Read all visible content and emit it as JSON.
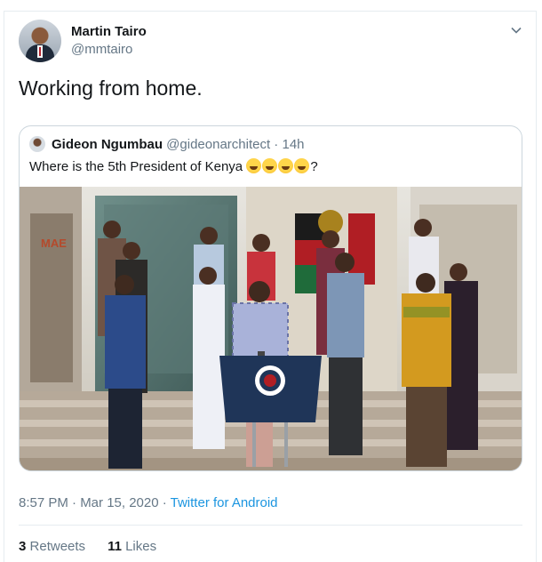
{
  "tweet": {
    "author_name": "Martin Tairo",
    "author_handle": "@mmtairo",
    "text": "Working from home.",
    "timestamp": "8:57 PM · Mar 15, 2020 · ",
    "source": "Twitter for Android",
    "retweets_count": "3",
    "retweets_label": "Retweets",
    "likes_count": "11",
    "likes_label": "Likes"
  },
  "quoted": {
    "author_name": "Gideon Ngumbau",
    "author_handle": "@gideonarchitect",
    "time": " · 14h",
    "text": "Where is the 5th President of Kenya ",
    "text_suffix": "?",
    "emoji_count": 4
  },
  "colors": {
    "link": "#1b95e0",
    "muted": "#657786",
    "border": "#ccd6dd"
  },
  "icons": [
    "caret-down-icon"
  ]
}
